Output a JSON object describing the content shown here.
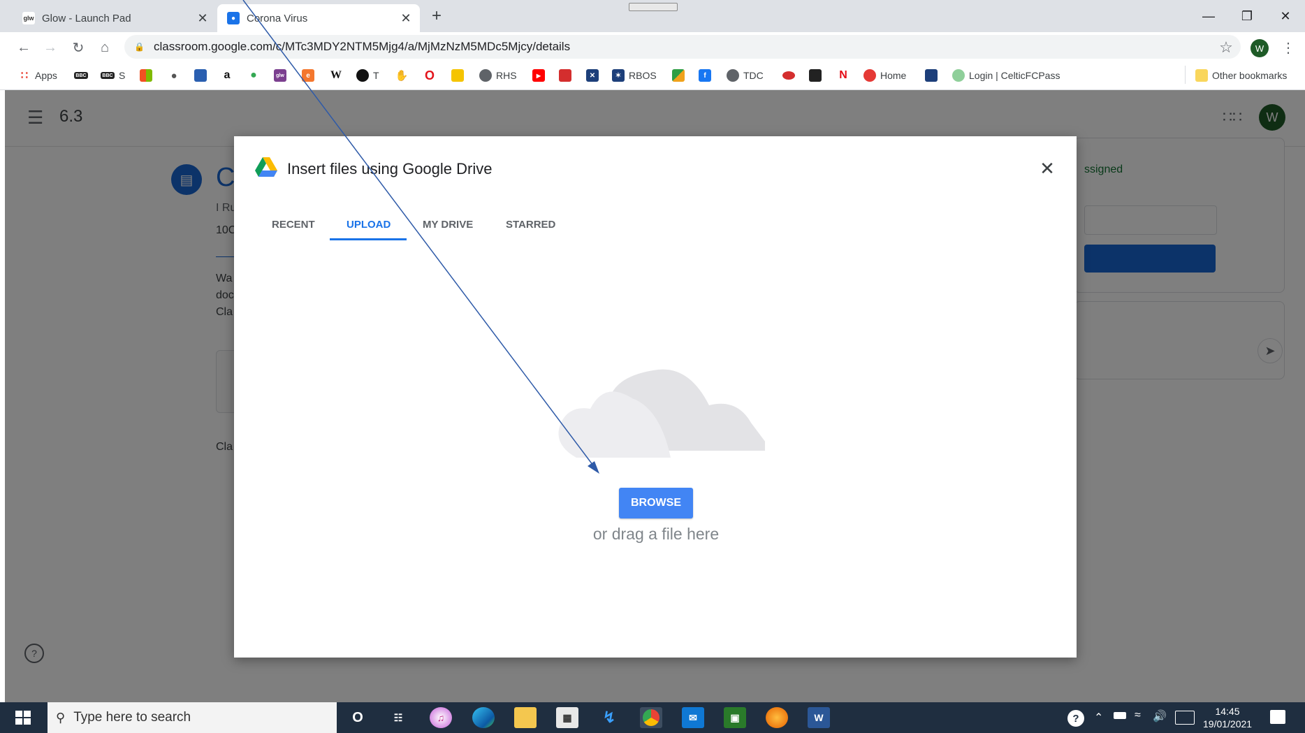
{
  "browser": {
    "tabs": [
      {
        "title": "Glow - Launch Pad",
        "favicon": "glow-icon",
        "close": "✕"
      },
      {
        "title": "Corona Virus",
        "favicon": "classroom-icon",
        "close": "✕"
      }
    ],
    "new_tab": "+",
    "window_controls": {
      "minimize": "—",
      "restore": "❐",
      "close": "✕"
    },
    "url": "classroom.google.com/c/MTc3MDY2NTM5Mjg4/a/MjMzNzM5MDc5Mjcy/details",
    "profile_initial": "W"
  },
  "bookmarks": [
    {
      "label": "Apps",
      "icon": "apps-grid-icon"
    },
    {
      "label": "",
      "icon": "bbc-icon"
    },
    {
      "label": "S",
      "icon": "bbc-sport-icon"
    },
    {
      "label": "",
      "icon": "microsoft-icon"
    },
    {
      "label": "",
      "icon": "apple-icon"
    },
    {
      "label": "",
      "icon": "shopping-bag-icon"
    },
    {
      "label": "",
      "icon": "amazon-icon"
    },
    {
      "label": "",
      "icon": "maps-pin-icon"
    },
    {
      "label": "",
      "icon": "glow-icon"
    },
    {
      "label": "",
      "icon": "e-icon"
    },
    {
      "label": "",
      "icon": "wikipedia-icon"
    },
    {
      "label": "T",
      "icon": "t-icon"
    },
    {
      "label": "",
      "icon": "hand-icon"
    },
    {
      "label": "",
      "icon": "opera-icon"
    },
    {
      "label": "",
      "icon": "yellow-icon"
    },
    {
      "label": "RHS",
      "icon": "globe-icon"
    },
    {
      "label": "",
      "icon": "youtube-icon"
    },
    {
      "label": "",
      "icon": "red-box-icon"
    },
    {
      "label": "",
      "icon": "blue-cross-icon"
    },
    {
      "label": "RBOS",
      "icon": "rbos-icon"
    },
    {
      "label": "",
      "icon": "flag-icon"
    },
    {
      "label": "",
      "icon": "facebook-icon"
    },
    {
      "label": "TDC",
      "icon": "globe-icon"
    },
    {
      "label": "",
      "icon": "red-oval-icon"
    },
    {
      "label": "",
      "icon": "dark-square-icon"
    },
    {
      "label": "",
      "icon": "netflix-icon"
    },
    {
      "label": "Home",
      "icon": "red-circle-icon"
    },
    {
      "label": "",
      "icon": "blue-square-icon"
    },
    {
      "label": "Login | CelticFCPass",
      "icon": "celtic-icon"
    }
  ],
  "other_bookmarks": "Other bookmarks",
  "classroom": {
    "title": "6.3",
    "assignment_title_fragment": "C",
    "status_fragment": "ssigned",
    "body_fragments": [
      "I Ru",
      "10C",
      "Wa",
      "doc",
      "Cla",
      "Cla"
    ],
    "user_initial": "W",
    "help_icon": "?"
  },
  "dialog": {
    "title": "Insert files using Google Drive",
    "tabs": [
      "RECENT",
      "UPLOAD",
      "MY DRIVE",
      "STARRED"
    ],
    "active_tab": "UPLOAD",
    "browse_label": "BROWSE",
    "drag_text": "or drag a file here",
    "close": "✕"
  },
  "taskbar": {
    "search_placeholder": "Type here to search",
    "time": "14:45",
    "date": "19/01/2021",
    "apps": [
      "cortana-icon",
      "task-view-icon",
      "itunes-icon",
      "edge-icon",
      "file-explorer-icon",
      "store-icon",
      "bolt-icon",
      "chrome-icon",
      "mail-icon",
      "monitor-app-icon",
      "firefox-icon",
      "word-icon"
    ]
  }
}
